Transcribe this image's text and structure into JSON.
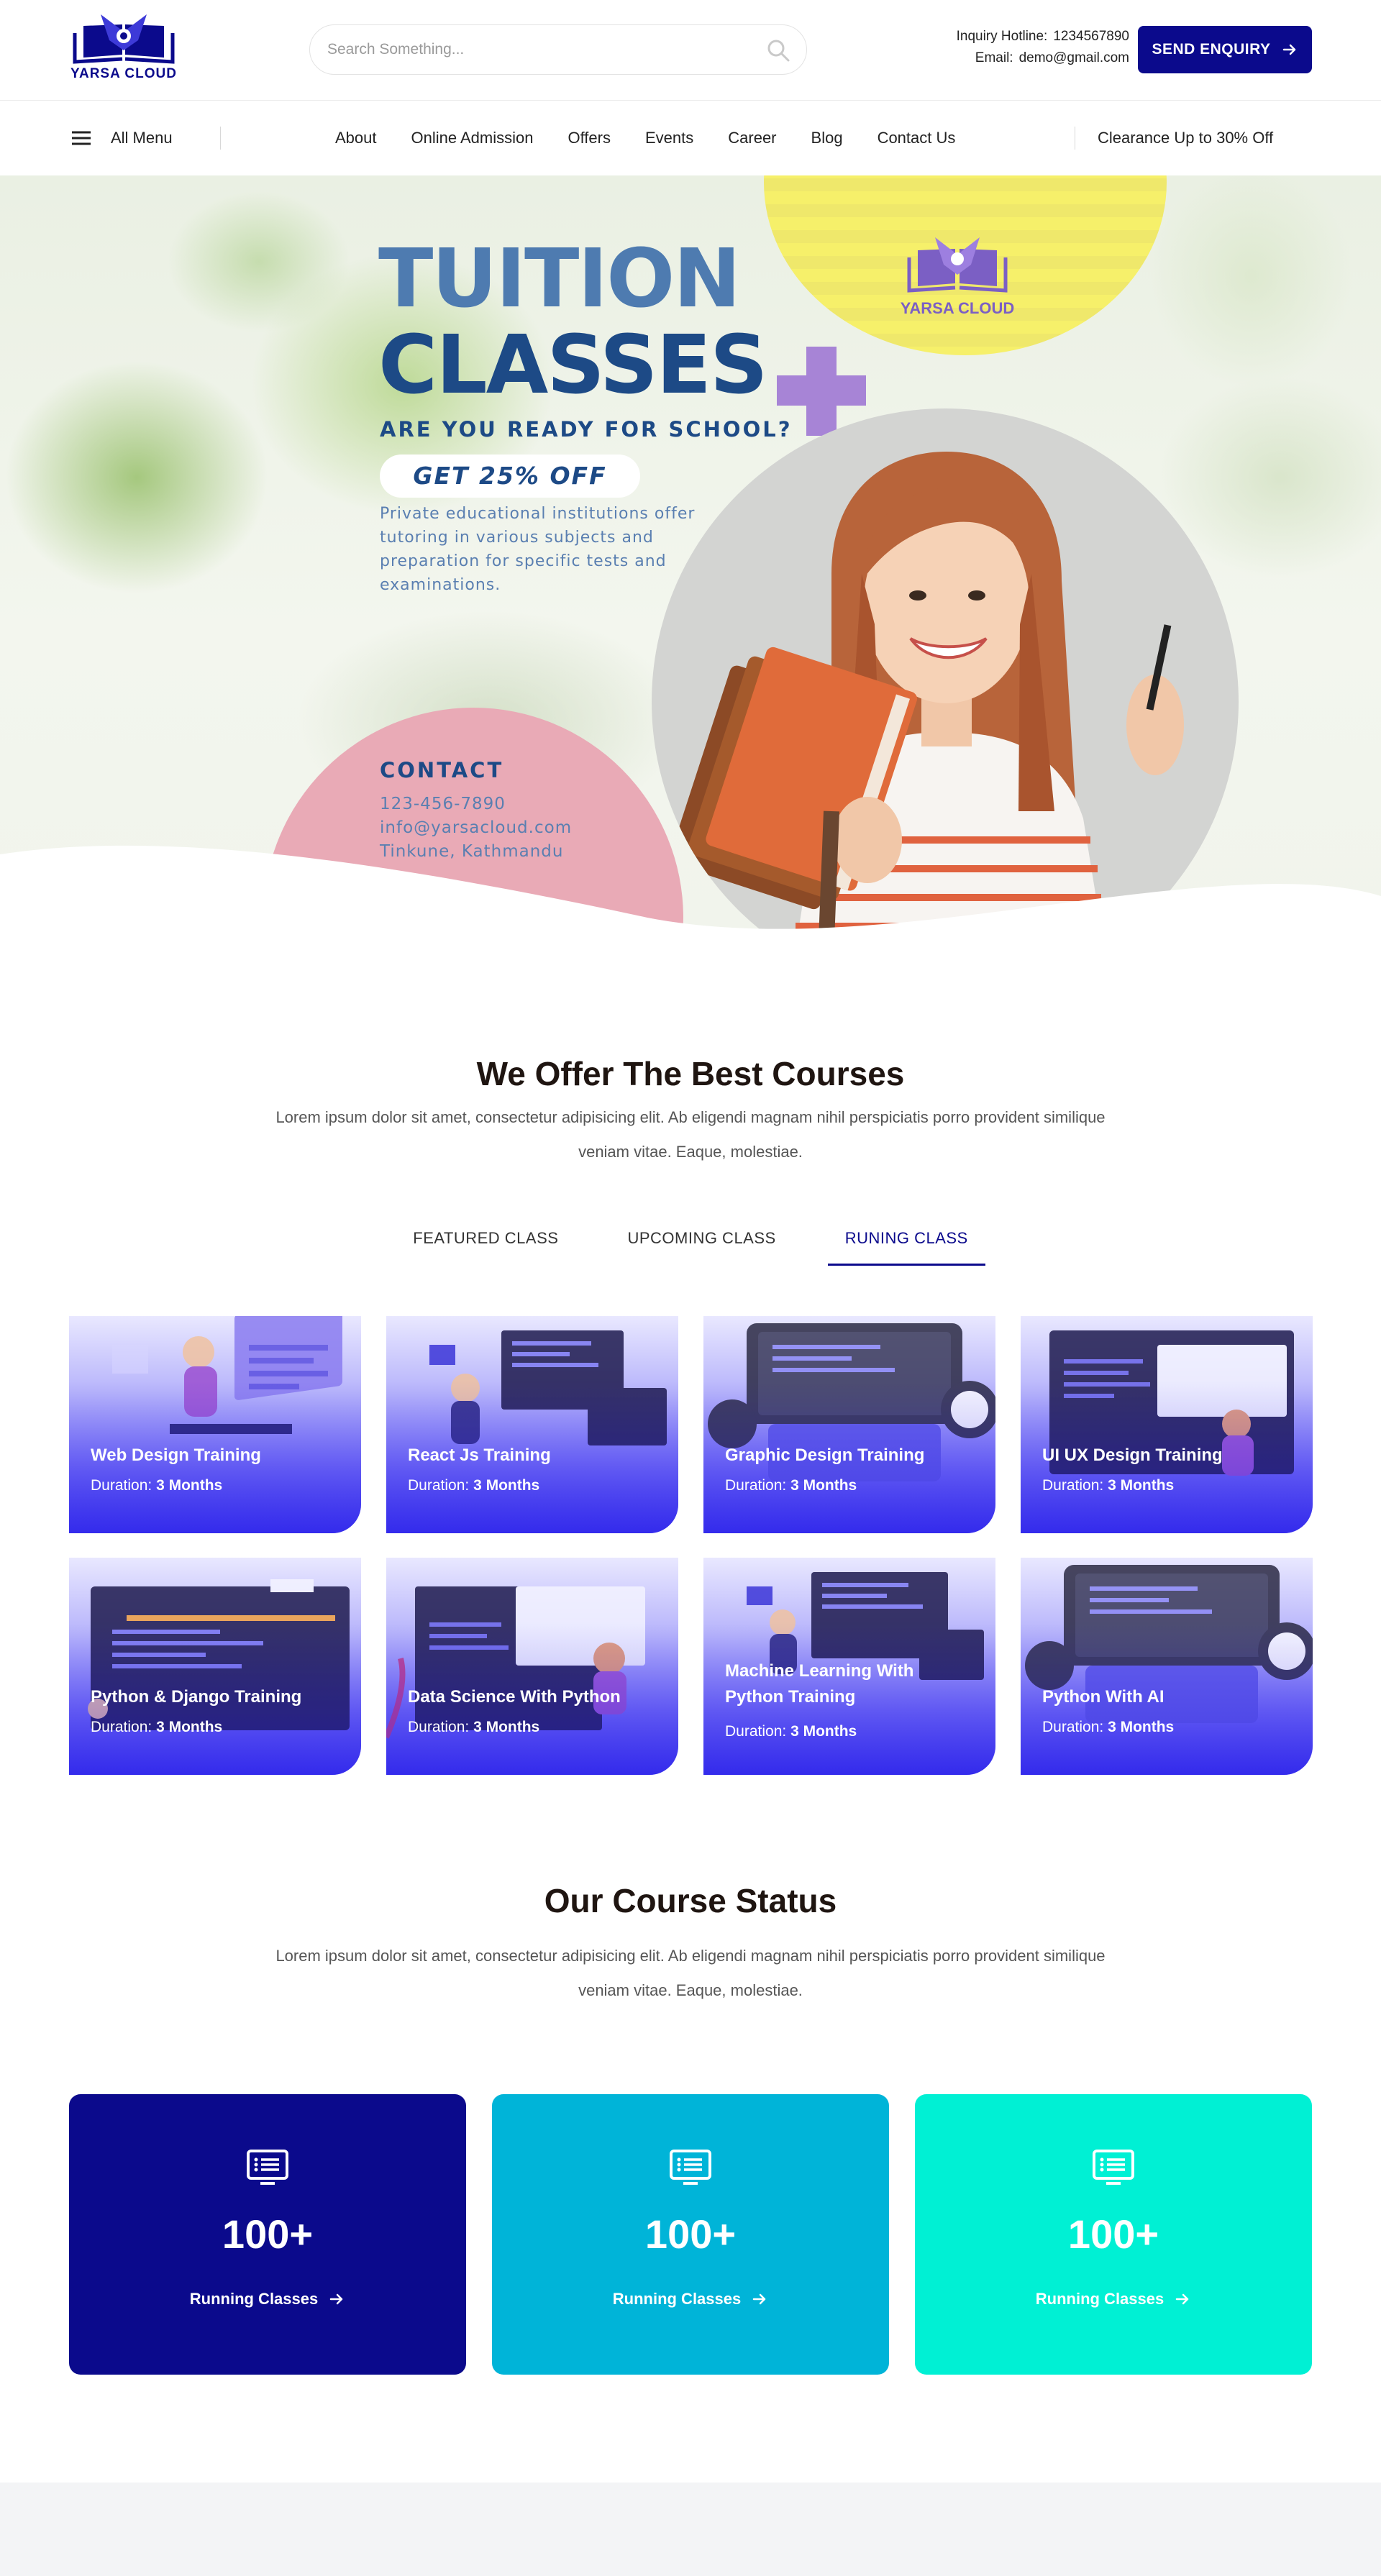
{
  "header": {
    "logo_text": "YARSA CLOUD",
    "search_placeholder": "Search Something...",
    "hotline_label": "Inquiry Hotline:",
    "hotline_value": "1234567890",
    "email_label": "Email:",
    "email_value": "demo@gmail.com",
    "enquiry_button": "SEND ENQUIRY"
  },
  "nav": {
    "all_menu": "All Menu",
    "links": [
      "About",
      "Online Admission",
      "Offers",
      "Events",
      "Career",
      "Blog",
      "Contact Us"
    ],
    "promo": "Clearance Up to 30% Off"
  },
  "hero": {
    "title_line1": "TUITION",
    "title_line2": "CLASSES",
    "subtitle": "ARE YOU READY FOR SCHOOL?",
    "offer": "GET 25% OFF",
    "description": "Private educational institutions offer tutoring in various subjects and preparation for specific tests and examinations.",
    "contact_title": "CONTACT",
    "phone": "123-456-7890",
    "email": "info@yarsacloud.com",
    "address": "Tinkune, Kathmandu",
    "badge_logo_text": "YARSA CLOUD"
  },
  "courses_section": {
    "title": "We Offer The Best Courses",
    "description": "Lorem ipsum dolor sit amet, consectetur adipisicing elit. Ab eligendi magnam nihil perspiciatis porro provident similique veniam vitae. Eaque, molestiae.",
    "tabs": [
      "FEATURED CLASS",
      "UPCOMING CLASS",
      "RUNING CLASS"
    ],
    "active_tab": "RUNING CLASS",
    "duration_label": "Duration:",
    "courses": [
      {
        "name": "Web Design Training",
        "duration": "3 Months"
      },
      {
        "name": "React Js Training",
        "duration": "3 Months"
      },
      {
        "name": "Graphic Design Training",
        "duration": "3 Months"
      },
      {
        "name": "UI UX Design Training",
        "duration": "3 Months"
      },
      {
        "name": "Python & Django Training",
        "duration": "3 Months"
      },
      {
        "name": "Data Science With Python",
        "duration": "3 Months"
      },
      {
        "name": "Machine Learning With Python Training",
        "duration": "3 Months"
      },
      {
        "name": "Python With AI",
        "duration": "3 Months"
      }
    ]
  },
  "status_section": {
    "title": "Our Course Status",
    "description": "Lorem ipsum dolor sit amet, consectetur adipisicing elit. Ab eligendi magnam nihil perspiciatis porro provident similique veniam vitae. Eaque, molestiae.",
    "cards": [
      {
        "value": "100+",
        "label": "Running Classes",
        "icon": "monitor-list-icon",
        "color": "#0b0a8c"
      },
      {
        "value": "100+",
        "label": "Running Classes",
        "icon": "monitor-list-icon",
        "color": "#00b4d8"
      },
      {
        "value": "100+",
        "label": "Running Classes",
        "icon": "monitor-list-icon",
        "color": "#00f0d4"
      }
    ]
  },
  "colors": {
    "brand": "#0b0a8c",
    "hero_title_light": "#4e7bb0",
    "hero_title_dark": "#1d4a86",
    "pink": "#e9aab6",
    "yellow": "#f6f06a",
    "purple_plus": "#a784d6"
  }
}
